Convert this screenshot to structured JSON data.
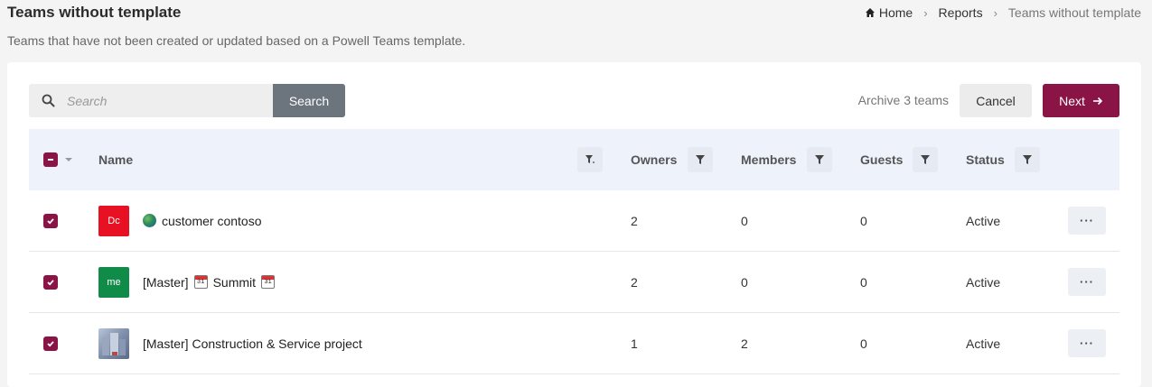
{
  "header": {
    "title": "Teams without template",
    "description": "Teams that have not been created or updated based on a Powell Teams template."
  },
  "breadcrumb": {
    "home": "Home",
    "reports": "Reports",
    "current": "Teams without template"
  },
  "toolbar": {
    "search_placeholder": "Search",
    "search_button": "Search",
    "archive_label": "Archive 3 teams",
    "cancel_button": "Cancel",
    "next_button": "Next"
  },
  "table": {
    "columns": {
      "name": "Name",
      "owners": "Owners",
      "members": "Members",
      "guests": "Guests",
      "status": "Status"
    },
    "rows": [
      {
        "avatar_text": "Dc",
        "avatar_color": "#e81123",
        "name": "customer contoso",
        "owners": "2",
        "members": "0",
        "guests": "0",
        "status": "Active",
        "more": "···"
      },
      {
        "avatar_text": "me",
        "avatar_color": "#108b48",
        "name_prefix": "[Master]",
        "name": "Summit",
        "cal_num": "31",
        "owners": "2",
        "members": "0",
        "guests": "0",
        "status": "Active",
        "more": "···"
      },
      {
        "avatar_text": "",
        "avatar_color": "#8a9bb5",
        "name": "[Master] Construction & Service project",
        "owners": "1",
        "members": "2",
        "guests": "0",
        "status": "Active",
        "more": "···"
      }
    ]
  },
  "colors": {
    "accent": "#8a1446",
    "search_button": "#6c757d",
    "header_bg": "#eef2fb"
  }
}
